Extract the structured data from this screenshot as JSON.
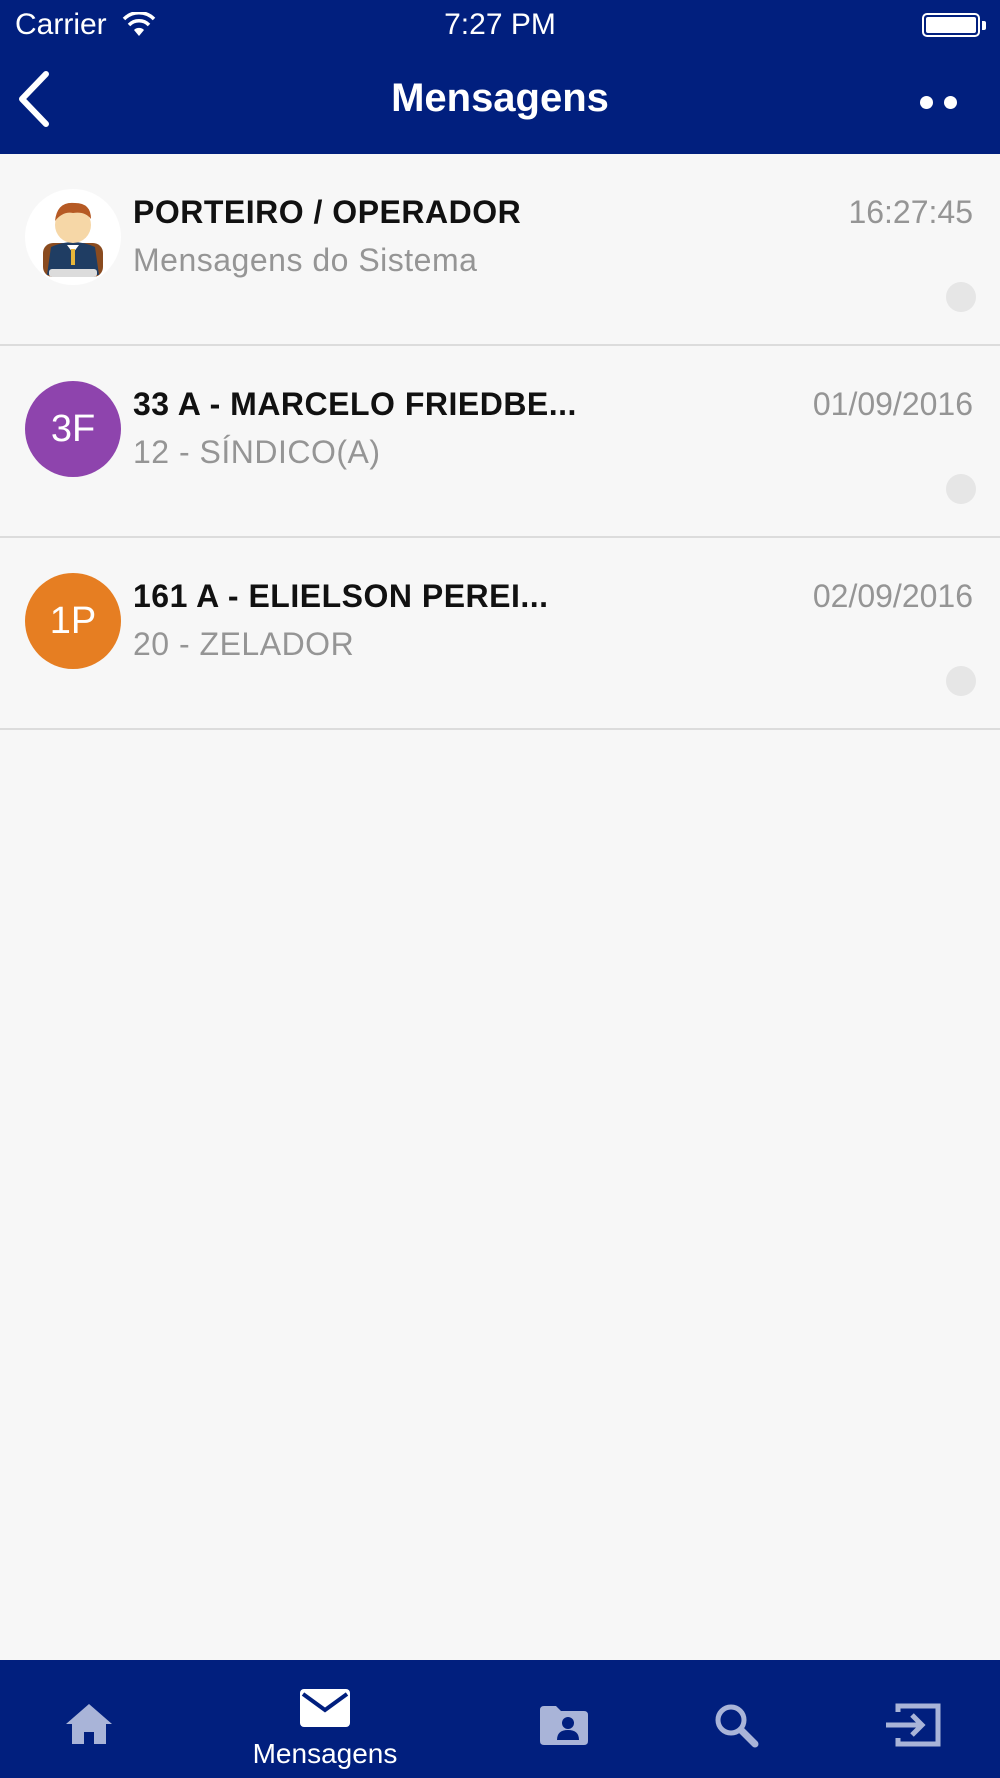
{
  "status_bar": {
    "carrier": "Carrier",
    "time": "7:27 PM"
  },
  "nav": {
    "title": "Mensagens"
  },
  "messages": [
    {
      "avatar_type": "image",
      "avatar_icon": "operator-avatar-icon",
      "name": "PORTEIRO / OPERADOR",
      "subtitle": "Mensagens do Sistema",
      "time": "16:27:45"
    },
    {
      "avatar_type": "initials",
      "initials": "3F",
      "avatar_color": "#8e44ad",
      "name": "33 A - MARCELO FRIEDBE...",
      "subtitle": "12 - SÍNDICO(A)",
      "time": "01/09/2016"
    },
    {
      "avatar_type": "initials",
      "initials": "1P",
      "avatar_color": "#e67e22",
      "name": "161 A - ELIELSON PEREI...",
      "subtitle": "20 - ZELADOR",
      "time": "02/09/2016"
    }
  ],
  "tab_bar": {
    "active": "Mensagens",
    "tabs": [
      {
        "icon": "home-icon",
        "label": ""
      },
      {
        "icon": "mail-icon",
        "label": "Mensagens"
      },
      {
        "icon": "contact-folder-icon",
        "label": ""
      },
      {
        "icon": "search-icon",
        "label": ""
      },
      {
        "icon": "logout-icon",
        "label": ""
      }
    ]
  },
  "colors": {
    "primary": "#011f7e",
    "background": "#f7f7f7",
    "tab_inactive": "#a9b4d8",
    "muted_text": "#959595"
  }
}
